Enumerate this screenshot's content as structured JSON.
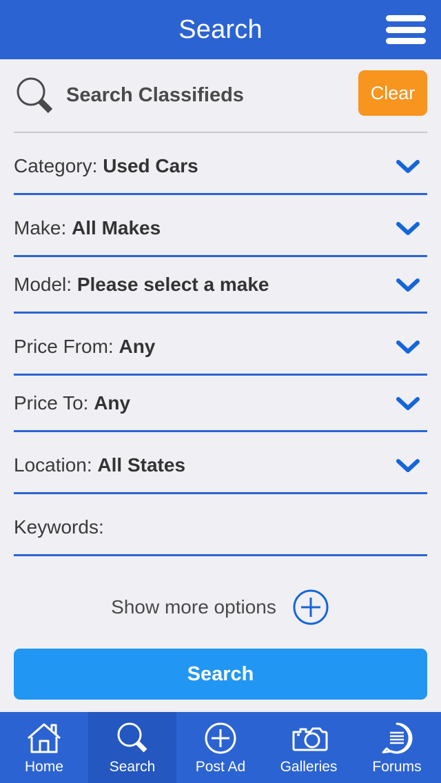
{
  "header": {
    "title": "Search",
    "menu_icon": "hamburger-menu-icon"
  },
  "search_bar": {
    "icon": "magnifier-icon",
    "title": "Search Classifieds",
    "clear_label": "Clear"
  },
  "form": {
    "rows": [
      {
        "label": "Category:",
        "value": "Used Cars",
        "icon": "chevron-down-icon",
        "name": "category"
      },
      {
        "label": "Make:",
        "value": "All Makes",
        "icon": "chevron-down-icon",
        "name": "make"
      },
      {
        "label": "Model:",
        "value": "Please select a make",
        "icon": "chevron-down-icon",
        "name": "model"
      },
      {
        "label": "Price From:",
        "value": "Any",
        "icon": "chevron-down-icon",
        "name": "price-from"
      },
      {
        "label": "Price To:",
        "value": "Any",
        "icon": "chevron-down-icon",
        "name": "price-to"
      },
      {
        "label": "Location:",
        "value": "All States",
        "icon": "chevron-down-icon",
        "name": "location"
      },
      {
        "label": "Keywords:",
        "value": "",
        "icon": "",
        "name": "keywords"
      }
    ]
  },
  "more_options": {
    "label": "Show more options",
    "icon": "plus-circle-icon"
  },
  "submit": {
    "label": "Search"
  },
  "tabbar": {
    "items": [
      {
        "label": "Home",
        "icon": "home-icon",
        "active": false
      },
      {
        "label": "Search",
        "icon": "magnifier-icon",
        "active": true
      },
      {
        "label": "Post Ad",
        "icon": "plus-circle-icon",
        "active": false
      },
      {
        "label": "Galleries",
        "icon": "camera-icon",
        "active": false
      },
      {
        "label": "Forums",
        "icon": "speech-bubble-icon",
        "active": false
      }
    ]
  },
  "colors": {
    "header_blue": "#2C63D2",
    "active_tab_blue": "#2457BF",
    "accent_orange": "#F7951E",
    "button_blue": "#2196F3",
    "underline_blue": "#2C63D2",
    "background": "#EFEFF4",
    "text_dark": "#3A3A3A"
  }
}
